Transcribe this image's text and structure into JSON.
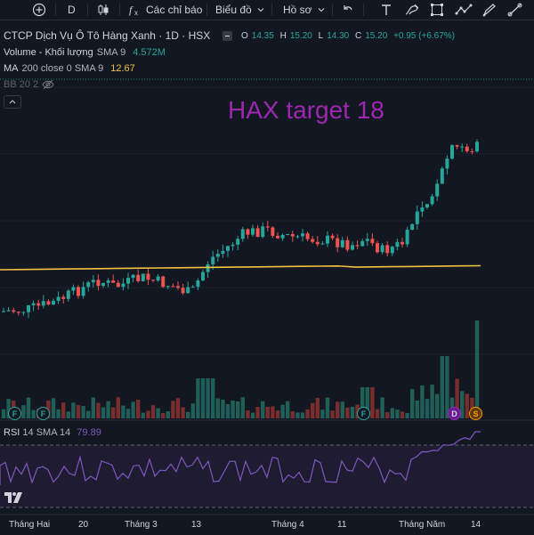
{
  "toolbar": {
    "add_icon": "plus-circle-icon",
    "interval": "D",
    "chart_type_icon": "candles-icon",
    "indicators_icon": "fx-icon",
    "indicators_label": "Các chỉ báo",
    "layout_label": "Biểu đồ",
    "profile_label": "Hồ sơ",
    "tools": [
      "undo-icon",
      "text-tool-icon",
      "brush-icon",
      "rectangle-icon",
      "path-icon",
      "pen-icon",
      "ruler-icon"
    ]
  },
  "legend": {
    "symbol_name": "CTCP Dịch Vụ Ô Tô Hàng Xanh · 1D · HSX",
    "o_label": "O",
    "o_value": "14.35",
    "h_label": "H",
    "h_value": "15.20",
    "l_label": "L",
    "l_value": "14.30",
    "c_label": "C",
    "c_value": "15.20",
    "change": "+0.95 (+6.67%)",
    "volume_label": "Volume - Khối lượng",
    "volume_params": "SMA 9",
    "volume_value": "4.572M",
    "ma_label": "MA",
    "ma_params": "200 close 0 SMA 9",
    "ma_value": "12.67",
    "bb_label": "BB 20 2"
  },
  "annotation": "HAX target 18",
  "rsi": {
    "label": "RSI",
    "params": "14 SMA 14",
    "value": "79.89"
  },
  "x_axis": {
    "labels": [
      "Tháng Hai",
      "20",
      "Tháng 3",
      "13",
      "Tháng 4",
      "11",
      "Tháng Năm",
      "14"
    ]
  },
  "events": [
    "F",
    "F",
    "F",
    "D",
    "S"
  ],
  "colors": {
    "background": "#131722",
    "up": "#26a69a",
    "down": "#ef5350",
    "ma_line": "#f0c040",
    "rsi_line": "#7e57c2",
    "annotation": "#9c27b0"
  }
}
